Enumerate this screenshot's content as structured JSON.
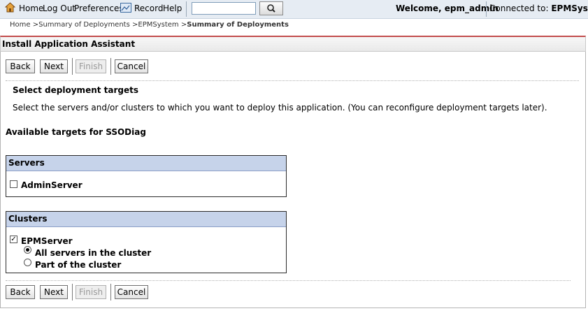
{
  "toolbar": {
    "home": "Home",
    "logout": "Log Out",
    "preferences": "Preferences",
    "record": "Record",
    "help": "Help",
    "search_value": "",
    "welcome": "Welcome, epm_admin",
    "connected_label": "Connected to:",
    "connected_target": "EPMSystem"
  },
  "breadcrumb": {
    "home": "Home",
    "sep": ">",
    "summary": "Summary of Deployments",
    "epmsystem": "EPMSystem",
    "current": "Summary of Deployments"
  },
  "panel": {
    "title": "Install Application Assistant"
  },
  "buttons": {
    "back": "Back",
    "next": "Next",
    "finish": "Finish",
    "cancel": "Cancel"
  },
  "content": {
    "section_title": "Select deployment targets",
    "description": "Select the servers and/or clusters to which you want to deploy this application. (You can reconfigure deployment targets later).",
    "available_targets": "Available targets for SSODiag"
  },
  "servers": {
    "header": "Servers",
    "items": [
      {
        "label": "AdminServer",
        "checked": false
      }
    ]
  },
  "clusters": {
    "header": "Clusters",
    "items": [
      {
        "label": "EPMServer",
        "checked": true
      }
    ],
    "options": [
      {
        "label": "All servers in the cluster",
        "selected": true
      },
      {
        "label": "Part of the cluster",
        "selected": false
      }
    ]
  }
}
